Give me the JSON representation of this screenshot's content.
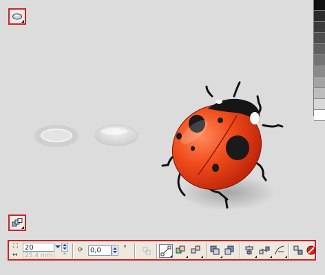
{
  "toolbar": {
    "size_value": "20",
    "width_value": "25,4 mm",
    "angle_value": "0,0",
    "degree_symbol": "°"
  },
  "palette": [
    "#111111",
    "#2b2b2b",
    "#3c3c3c",
    "#4e4e4e",
    "#606060",
    "#747474",
    "#8b8b8b",
    "#a3a3a3",
    "#bdbdbd",
    "#d8d8d8",
    "#ffffff"
  ],
  "icons": {
    "top_tool": "ellipse-tool-icon",
    "bottom_tool": "arrange-tool-icon"
  }
}
